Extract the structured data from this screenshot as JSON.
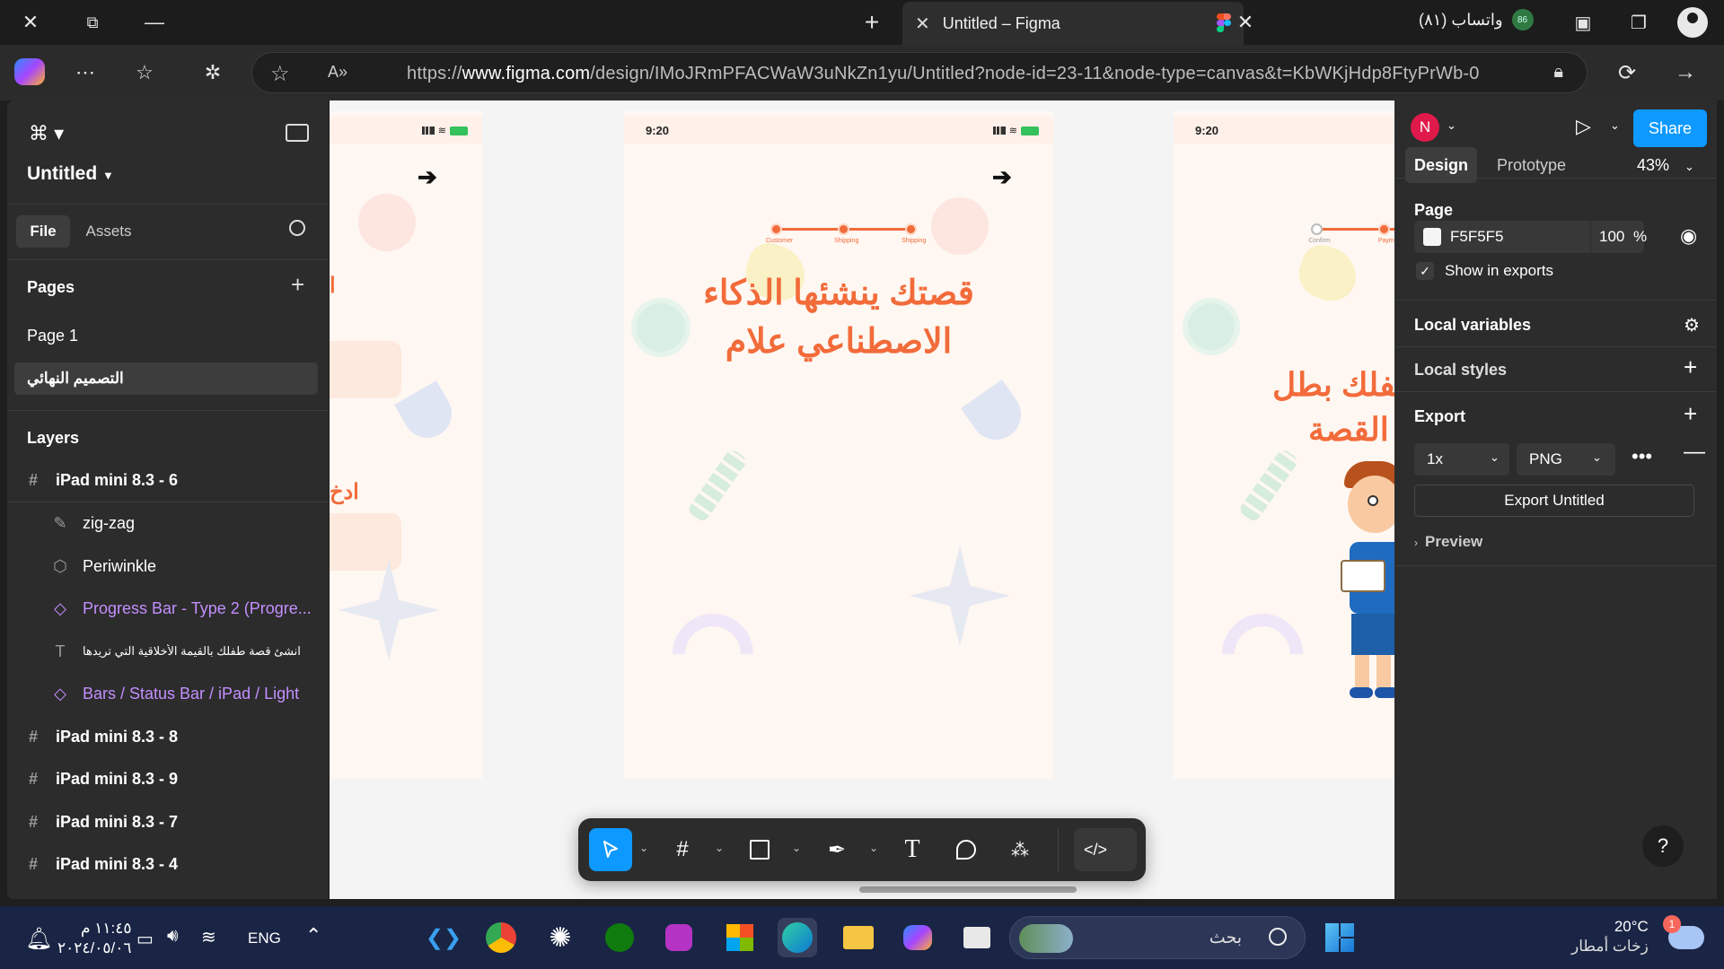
{
  "browser": {
    "tab_title": "Untitled – Figma",
    "whatsapp_label": "واتساب (٨١)",
    "whatsapp_badge": "86",
    "url_prefix": "https://",
    "url_host": "www.figma.com",
    "url_path": "/design/IMoJRmPFACWaW3uNkZn1yu/Untitled?node-id=23-11&node-type=canvas&t=KbWKjHdp8FtyPrWb-0"
  },
  "left_panel": {
    "file_title": "Untitled",
    "tabs": [
      "File",
      "Assets"
    ],
    "pages_heading": "Pages",
    "pages": [
      "Page 1",
      "التصميم النهائي"
    ],
    "layers_heading": "Layers",
    "layers": [
      {
        "name": "iPad mini 8.3 - 6",
        "icon": "frame-icon",
        "indent": false,
        "component": false
      },
      {
        "name": "zig-zag",
        "icon": "pen-icon",
        "indent": true,
        "component": false
      },
      {
        "name": "Periwinkle",
        "icon": "shape-icon",
        "indent": true,
        "component": false
      },
      {
        "name": "Progress Bar - Type 2 (Progre...",
        "icon": "component-icon",
        "indent": true,
        "component": true
      },
      {
        "name": "انشئ قصة طفلك بالقيمة الأخلاقية التي تريدها",
        "icon": "text-icon",
        "indent": true,
        "component": false
      },
      {
        "name": "Bars / Status Bar / iPad / Light",
        "icon": "component-icon",
        "indent": true,
        "component": true
      },
      {
        "name": "iPad mini 8.3 - 8",
        "icon": "frame-icon",
        "indent": false,
        "component": false
      },
      {
        "name": "iPad mini 8.3 - 9",
        "icon": "frame-icon",
        "indent": false,
        "component": false
      },
      {
        "name": "iPad mini 8.3 - 7",
        "icon": "frame-icon",
        "indent": false,
        "component": false
      },
      {
        "name": "iPad mini 8.3 - 4",
        "icon": "frame-icon",
        "indent": false,
        "component": false
      }
    ]
  },
  "canvas": {
    "status_time": "9:20",
    "center_headline_line1": "قصتك ينشئها الذكاء",
    "center_headline_line2": "الاصطناعي علام",
    "right_headline_line1": "طفلك بطل",
    "right_headline_line2": "القصة",
    "left_partial_text1": "ا",
    "left_partial_text2": "ادخ",
    "progress_labels": [
      "Customer",
      "Shipping",
      "Shipping"
    ],
    "progress_labels_right": [
      "Confirm",
      "Paym"
    ],
    "accent": "#f26b3a"
  },
  "toolbar": {
    "tools": [
      "move-tool",
      "frame-tool",
      "rectangle-tool",
      "pen-tool",
      "text-tool",
      "comment-tool",
      "actions-tool",
      "dev-mode-toggle"
    ]
  },
  "right_panel": {
    "avatar_letter": "N",
    "share_label": "Share",
    "tabs": [
      "Design",
      "Prototype"
    ],
    "zoom": "43%",
    "page_heading": "Page",
    "page_color": "F5F5F5",
    "page_opacity": "100",
    "percent": "%",
    "show_in_exports": "Show in exports",
    "local_variables": "Local variables",
    "local_styles": "Local styles",
    "export_heading": "Export",
    "export_scale": "1x",
    "export_format": "PNG",
    "export_button": "Export Untitled",
    "preview_label": "Preview",
    "help": "?"
  },
  "taskbar": {
    "time": "١١:٤٥ م",
    "date": "٢٠٢٤/٠٥/٠٦",
    "lang": "ENG",
    "search_placeholder": "بحث",
    "weather_temp": "20°C",
    "weather_desc": "زخات أمطار",
    "weather_badge": "1"
  }
}
